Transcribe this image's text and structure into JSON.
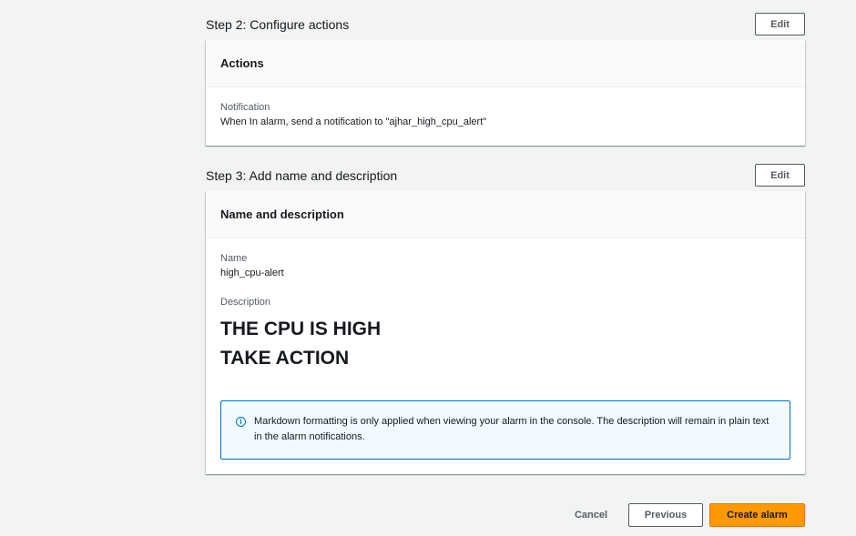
{
  "step2": {
    "title": "Step 2: Configure actions",
    "edit_label": "Edit",
    "card_header": "Actions",
    "notification_label": "Notification",
    "notification_value": "When In alarm, send a notification to \"ajhar_high_cpu_alert\""
  },
  "step3": {
    "title": "Step 3: Add name and description",
    "edit_label": "Edit",
    "card_header": "Name and description",
    "name_label": "Name",
    "name_value": "high_cpu-alert",
    "description_label": "Description",
    "description_lines": [
      "THE CPU IS HIGH",
      "TAKE ACTION"
    ],
    "info_text": "Markdown formatting is only applied when viewing your alarm in the console. The description will remain in plain text in the alarm notifications."
  },
  "footer": {
    "cancel_label": "Cancel",
    "previous_label": "Previous",
    "create_label": "Create alarm"
  },
  "colors": {
    "primary": "#ff9900",
    "info_border": "#0073bb",
    "info_bg": "#f1faff"
  }
}
